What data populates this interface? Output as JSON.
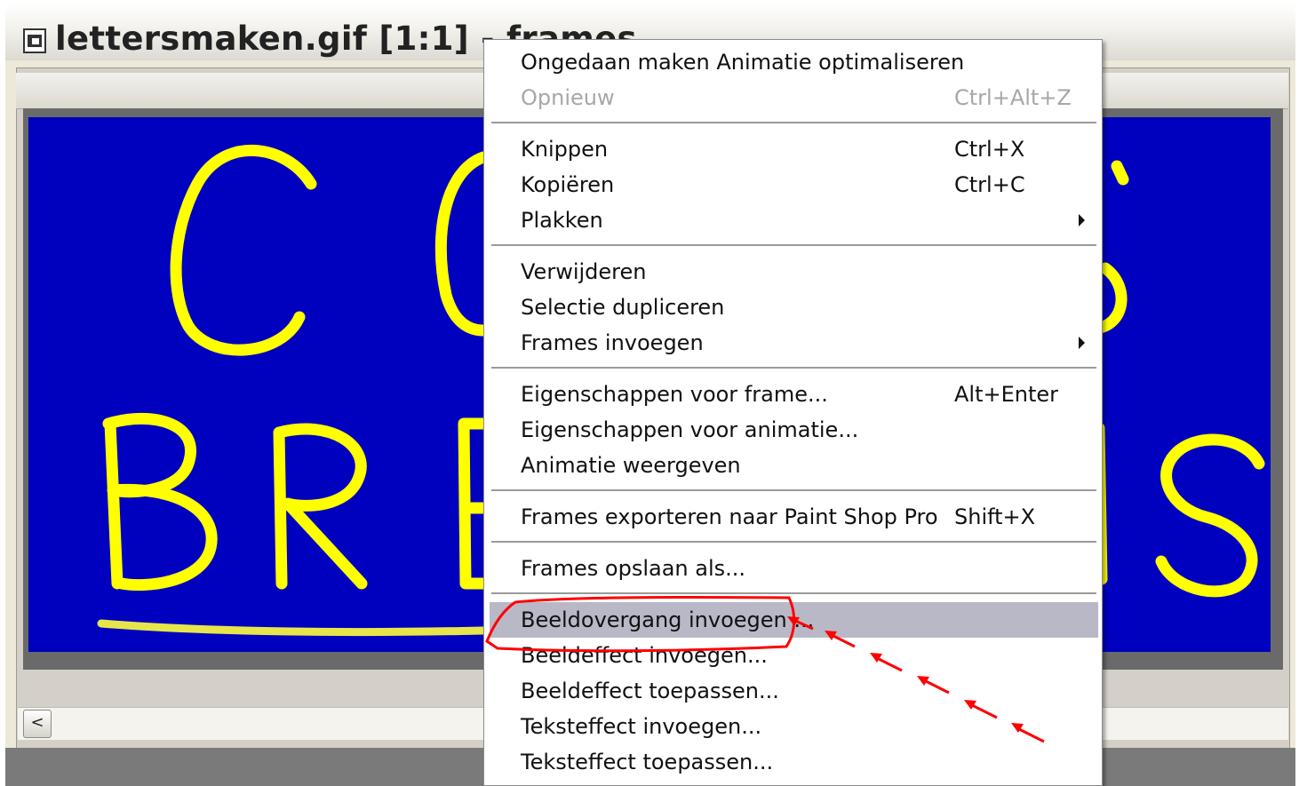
{
  "window": {
    "title": "lettersmaken.gif [1:1] - frames",
    "icon": "gif-file-icon"
  },
  "canvas": {
    "background": "#0000bf",
    "text_color": "#ffff00",
    "lines": [
      "C O",
      "B R E",
      "S"
    ]
  },
  "scrollbar": {
    "left_arrow": "<"
  },
  "context_menu": {
    "items": [
      {
        "label": "Ongedaan maken Animatie optimaliseren",
        "shortcut": ""
      },
      {
        "label": "Opnieuw",
        "shortcut": "Ctrl+Alt+Z",
        "disabled": true
      },
      {
        "label": "Knippen",
        "shortcut": "Ctrl+X"
      },
      {
        "label": "Kopiëren",
        "shortcut": "Ctrl+C"
      },
      {
        "label": "Plakken",
        "shortcut": "",
        "submenu": true
      },
      {
        "label": "Verwijderen",
        "shortcut": ""
      },
      {
        "label": "Selectie dupliceren",
        "shortcut": ""
      },
      {
        "label": "Frames invoegen",
        "shortcut": "",
        "submenu": true
      },
      {
        "label": "Eigenschappen voor frame...",
        "shortcut": "Alt+Enter"
      },
      {
        "label": "Eigenschappen voor animatie...",
        "shortcut": ""
      },
      {
        "label": "Animatie weergeven",
        "shortcut": ""
      },
      {
        "label": "Frames exporteren naar Paint Shop Pro",
        "shortcut": "Shift+X"
      },
      {
        "label": "Frames opslaan als...",
        "shortcut": ""
      },
      {
        "label": "Beeldovergang invoegen ...",
        "shortcut": "",
        "highlighted": true
      },
      {
        "label": "Beeldeffect invoegen...",
        "shortcut": ""
      },
      {
        "label": "Beeldeffect toepassen...",
        "shortcut": ""
      },
      {
        "label": "Teksteffect invoegen...",
        "shortcut": ""
      },
      {
        "label": "Teksteffect toepassen...",
        "shortcut": ""
      }
    ]
  },
  "annotation": {
    "color": "#ff0000"
  }
}
